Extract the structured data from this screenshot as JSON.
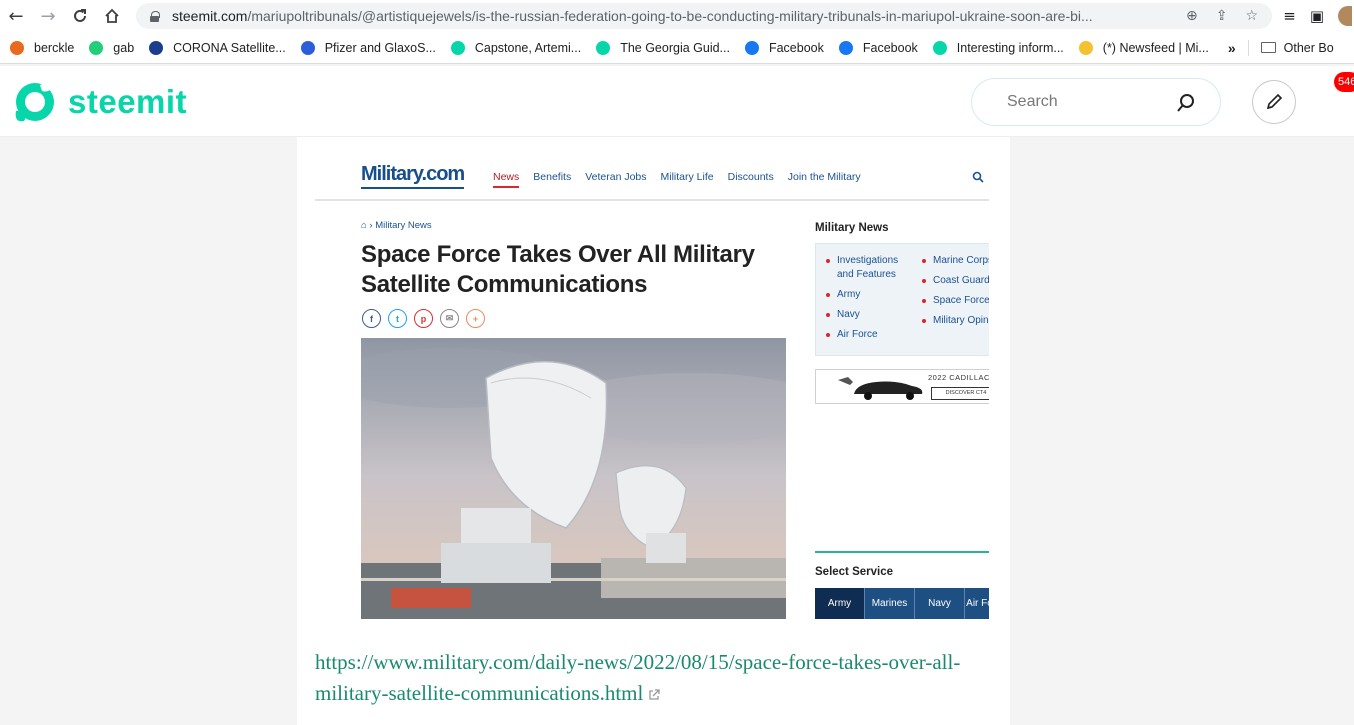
{
  "browser": {
    "url_host": "steemit.com",
    "url_path": "/mariupoltribunals/@artistiquejewels/is-the-russian-federation-going-to-be-conducting-military-tribunals-in-mariupol-ukraine-soon-are-bi...",
    "bookmarks": [
      {
        "label": "berckle",
        "color": "#e8691f",
        "icon": "duckduckgo-icon"
      },
      {
        "label": "gab",
        "color": "#21cf7a",
        "icon": "gab-icon"
      },
      {
        "label": "CORONA Satellite...",
        "color": "#1a3e8c",
        "icon": "d-logo-icon"
      },
      {
        "label": "Pfizer and GlaxoS...",
        "color": "#2b5fd9",
        "icon": "wave-logo-icon"
      },
      {
        "label": "Capstone, Artemi...",
        "color": "#06d6a9",
        "icon": "steemit-icon"
      },
      {
        "label": "The Georgia Guid...",
        "color": "#06d6a9",
        "icon": "steemit-icon"
      },
      {
        "label": "Facebook",
        "color": "#1877f2",
        "icon": "facebook-icon"
      },
      {
        "label": "Facebook",
        "color": "#1877f2",
        "icon": "facebook-icon"
      },
      {
        "label": "Interesting inform...",
        "color": "#06d6a9",
        "icon": "steemit-icon"
      },
      {
        "label": "(*) Newsfeed | Mi...",
        "color": "#f2c230",
        "icon": "lightbulb-icon"
      }
    ],
    "more_label": "»",
    "other_bookmarks": "Other Bo"
  },
  "site": {
    "logo_text": "steemit",
    "brand_color": "#06d6a9",
    "search_placeholder": "Search",
    "notification_count": "546"
  },
  "article": {
    "embedded": {
      "logo": "Military.com",
      "nav": [
        "News",
        "Benefits",
        "Veteran Jobs",
        "Military Life",
        "Discounts",
        "Join the Military"
      ],
      "active_nav": "News",
      "breadcrumb": "› Military News",
      "headline": "Space Force Takes Over All Military Satellite Communications",
      "share_icons": [
        "f",
        "t",
        "p",
        "✉",
        "+"
      ],
      "sidebar_title": "Military News",
      "sidebar_col1": [
        "Investigations and Features",
        "Army",
        "Navy",
        "Air Force"
      ],
      "sidebar_col2": [
        "Marine Corps",
        "Coast Guard",
        "Space Force",
        "Military Opini"
      ],
      "ad_text": "2022 CADILLAC",
      "ad_button": "DISCOVER CT4",
      "service_title": "Select Service",
      "service_tabs": [
        "Army",
        "Marines",
        "Navy",
        "Air Fo"
      ]
    },
    "link_text": "https://www.military.com/daily-news/2022/08/15/space-force-takes-over-all-military-satellite-communications.html"
  }
}
